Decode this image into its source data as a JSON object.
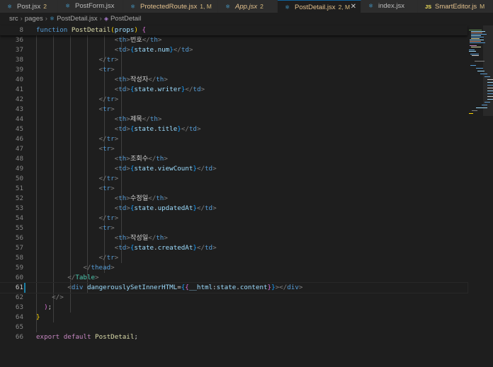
{
  "tabs": [
    {
      "label": "Post.jsx",
      "badge": "2",
      "icon": "react-icon",
      "type": "react"
    },
    {
      "label": "PostForm.jsx",
      "badge": "",
      "icon": "react-icon",
      "type": "react"
    },
    {
      "label": "ProtectedRoute.jsx",
      "badge": "1, M",
      "icon": "react-icon",
      "type": "react"
    },
    {
      "label": "App.jsx",
      "badge": "2",
      "icon": "react-icon",
      "type": "react"
    },
    {
      "label": "PostDetail.jsx",
      "badge": "2, M",
      "icon": "react-icon",
      "type": "react"
    },
    {
      "label": "index.jsx",
      "badge": "",
      "icon": "react-icon",
      "type": "react"
    },
    {
      "label": "SmartEditor.js",
      "badge": "M",
      "icon": "js-icon",
      "type": "js"
    }
  ],
  "breadcrumb": {
    "src": "src",
    "pages": "pages",
    "file": "PostDetail.jsx",
    "symbol": "PostDetail"
  },
  "sticky": {
    "num": "8",
    "text": "function PostDetail(props) {"
  },
  "colors": {
    "tag": "#569cd6",
    "bracket": "#808080",
    "prop": "#9cdcfe",
    "keyword": "#569cd6",
    "component": "#4ec9b0",
    "accent": "#0e639c"
  },
  "lines": [
    {
      "n": "36",
      "tag": "th",
      "text": "번호"
    },
    {
      "n": "37",
      "tag": "td",
      "expr": "state.num"
    },
    {
      "n": "38",
      "close": "tr"
    },
    {
      "n": "39",
      "open": "tr"
    },
    {
      "n": "40",
      "tag": "th",
      "text": "작성자"
    },
    {
      "n": "41",
      "tag": "td",
      "expr": "state.writer"
    },
    {
      "n": "42",
      "close": "tr"
    },
    {
      "n": "43",
      "open": "tr"
    },
    {
      "n": "44",
      "tag": "th",
      "text": "제목"
    },
    {
      "n": "45",
      "tag": "td",
      "expr": "state.title"
    },
    {
      "n": "46",
      "close": "tr"
    },
    {
      "n": "47",
      "open": "tr"
    },
    {
      "n": "48",
      "tag": "th",
      "text": "조회수"
    },
    {
      "n": "49",
      "tag": "td",
      "expr": "state.viewCount"
    },
    {
      "n": "50",
      "close": "tr"
    },
    {
      "n": "51",
      "open": "tr"
    },
    {
      "n": "52",
      "tag": "th",
      "text": "수정일"
    },
    {
      "n": "53",
      "tag": "td",
      "expr": "state.updatedAt"
    },
    {
      "n": "54",
      "close": "tr"
    },
    {
      "n": "55",
      "open": "tr"
    },
    {
      "n": "56",
      "tag": "th",
      "text": "작성일"
    },
    {
      "n": "57",
      "tag": "td",
      "expr": "state.createdAt"
    },
    {
      "n": "58",
      "close": "tr"
    },
    {
      "n": "59",
      "close": "thead"
    },
    {
      "n": "60",
      "close": "Table"
    },
    {
      "n": "61",
      "div": "div dangerouslySetInnerHTML={{__html:state.content}}></div>"
    },
    {
      "n": "62",
      "close": "/>"
    },
    {
      "n": "63",
      "paren": ");"
    },
    {
      "n": "64",
      "brace": "}"
    },
    {
      "n": "65",
      "empty": ""
    },
    {
      "n": "66",
      "export": "export default PostDetail;"
    }
  ]
}
